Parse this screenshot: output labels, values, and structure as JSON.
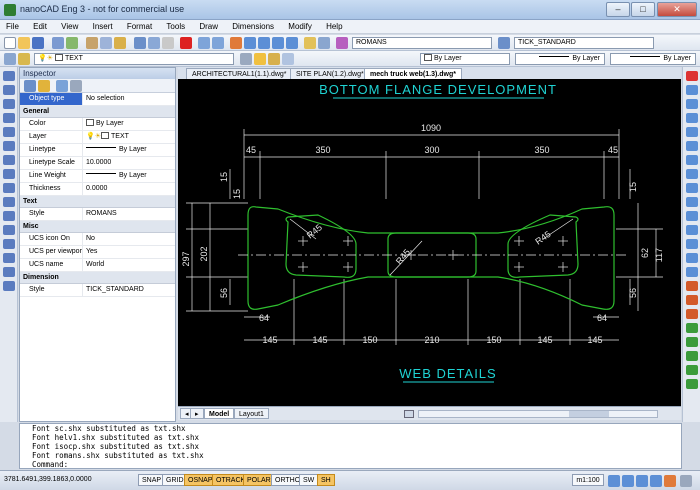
{
  "window": {
    "title": "nanoCAD Eng 3 - not for commercial use",
    "minimize": "–",
    "maximize": "□",
    "close": "✕"
  },
  "menu": [
    "File",
    "Edit",
    "View",
    "Insert",
    "Format",
    "Tools",
    "Draw",
    "Dimensions",
    "Modify",
    "Help"
  ],
  "toolbar": {
    "text_style": "ROMANS",
    "dim_style": "TICK_STANDARD",
    "layer": "TEXT",
    "color": "By Layer",
    "linetype": "By Layer",
    "lineweight": "By Layer"
  },
  "inspector": {
    "title": "Inspector",
    "object_type_label": "Object type",
    "object_type_value": "No selection",
    "sections": {
      "general": "General",
      "text": "Text",
      "misc": "Misc",
      "dimension": "Dimension"
    },
    "general": [
      {
        "k": "Color",
        "v": "By Layer"
      },
      {
        "k": "Layer",
        "v": "TEXT"
      },
      {
        "k": "Linetype",
        "v": "By Layer"
      },
      {
        "k": "Linetype Scale",
        "v": "10.0000"
      },
      {
        "k": "Line Weight",
        "v": "By Layer"
      },
      {
        "k": "Thickness",
        "v": "0.0000"
      }
    ],
    "text": [
      {
        "k": "Style",
        "v": "ROMANS"
      }
    ],
    "misc": [
      {
        "k": "UCS icon On",
        "v": "No"
      },
      {
        "k": "UCS per viewport",
        "v": "Yes"
      },
      {
        "k": "UCS name",
        "v": "World"
      }
    ],
    "dimension": [
      {
        "k": "Style",
        "v": "TICK_STANDARD"
      }
    ]
  },
  "doc_tabs": [
    "ARCHITECTURAL1(1.1).dwg*",
    "SITE PLAN(1.2).dwg*",
    "mech truck web(1.3).dwg*"
  ],
  "drawing": {
    "title": "BOTTOM FLANGE DEVELOPMENT",
    "footer": "WEB DETAILS",
    "dims_top": [
      "1090",
      "350",
      "300",
      "350",
      "45",
      "45"
    ],
    "dims_bottom": [
      "64",
      "64",
      "145",
      "145",
      "150",
      "210",
      "150",
      "145",
      "145"
    ],
    "dims_left": [
      "297",
      "202",
      "15",
      "15",
      "56"
    ],
    "dims_right": [
      "117",
      "62",
      "15",
      "56"
    ],
    "radii": [
      "R45",
      "R45",
      "R45"
    ]
  },
  "layout_tabs": [
    "Model",
    "Layout1"
  ],
  "command_lines": [
    "Font sc.shx substituted as txt.shx",
    "Font helv1.shx substituted as txt.shx",
    "Font isocp.shx substituted as txt.shx",
    "Font romans.shx substituted as txt.shx"
  ],
  "command_prompt": "Command:",
  "status": {
    "coords": "3781.6491,399.1863,0.0000",
    "buttons": [
      "SNAP",
      "GRID",
      "OSNAP",
      "OTRACK",
      "POLAR",
      "ORTHO",
      "SW",
      "SH"
    ],
    "scale": "m1:100"
  }
}
